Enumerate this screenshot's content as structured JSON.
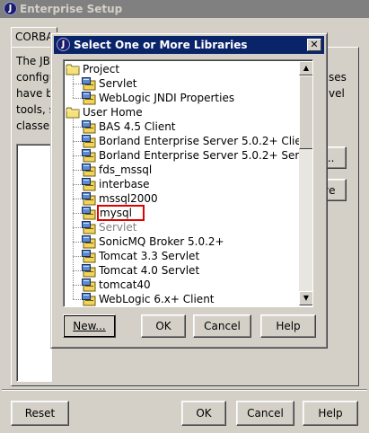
{
  "main_window": {
    "title": "Enterprise Setup",
    "tab_label": "CORBA",
    "text_lines": [
      "The JB",
      "configu",
      "have b",
      "tools, s",
      "classe"
    ],
    "right_fragments": [
      "ses",
      "vel"
    ],
    "side_buttons": [
      "...",
      "ve"
    ],
    "buttons": {
      "reset": "Reset",
      "ok": "OK",
      "cancel": "Cancel",
      "help": "Help"
    }
  },
  "dialog": {
    "title": "Select One or More Libraries",
    "tree": [
      {
        "label": "Project",
        "type": "folder"
      },
      {
        "label": "Servlet",
        "type": "library"
      },
      {
        "label": "WebLogic JNDI Properties",
        "type": "library"
      },
      {
        "label": "User Home",
        "type": "folder"
      },
      {
        "label": "BAS 4.5 Client",
        "type": "library"
      },
      {
        "label": "Borland Enterprise Server 5.0.2+ Client",
        "type": "library"
      },
      {
        "label": "Borland Enterprise Server 5.0.2+ Servlet",
        "type": "library"
      },
      {
        "label": "fds_mssql",
        "type": "library"
      },
      {
        "label": "interbase",
        "type": "library"
      },
      {
        "label": "mssql2000",
        "type": "library"
      },
      {
        "label": "mysql",
        "type": "library",
        "highlighted": true
      },
      {
        "label": "Servlet",
        "type": "library",
        "disabled": true
      },
      {
        "label": "SonicMQ Broker 5.0.2+",
        "type": "library"
      },
      {
        "label": "Tomcat 3.3 Servlet",
        "type": "library"
      },
      {
        "label": "Tomcat 4.0 Servlet",
        "type": "library"
      },
      {
        "label": "tomcat40",
        "type": "library"
      },
      {
        "label": "WebLogic 6.x+ Client",
        "type": "library"
      }
    ],
    "buttons": {
      "new": "New...",
      "ok": "OK",
      "cancel": "Cancel",
      "help": "Help"
    }
  },
  "colors": {
    "title_active": "#0a246a",
    "title_inactive": "#808080",
    "highlight_box": "#e00000",
    "disabled_text": "#808080"
  }
}
